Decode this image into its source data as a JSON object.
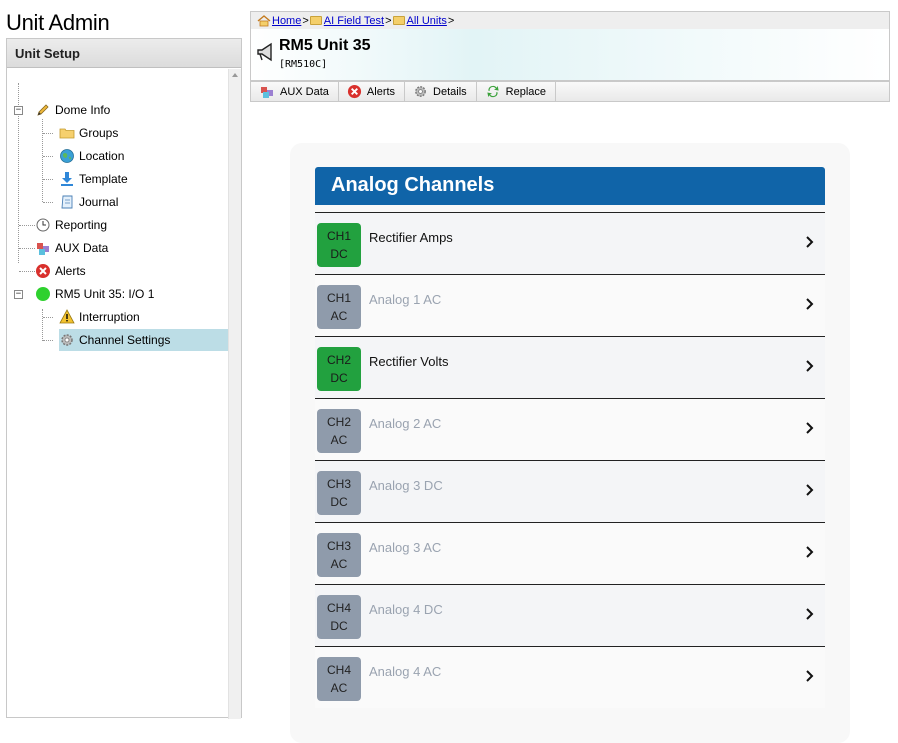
{
  "app": {
    "title": "Unit Admin"
  },
  "left_panel": {
    "header": "Unit Setup",
    "tree": [
      {
        "label": "Dome Info",
        "icon": "pencil-icon"
      },
      {
        "label": "Groups",
        "icon": "folder-icon"
      },
      {
        "label": "Location",
        "icon": "globe-icon"
      },
      {
        "label": "Template",
        "icon": "download-icon"
      },
      {
        "label": "Journal",
        "icon": "journal-icon"
      },
      {
        "label": "Reporting",
        "icon": "clock-icon"
      },
      {
        "label": "AUX Data",
        "icon": "cubes-icon"
      },
      {
        "label": "Alerts",
        "icon": "alert-x-icon"
      },
      {
        "label": "RM5 Unit 35: I/O 1",
        "icon": "green-status-icon"
      },
      {
        "label": "Interruption",
        "icon": "warning-icon"
      },
      {
        "label": "Channel Settings",
        "icon": "gear-icon",
        "selected": true
      }
    ]
  },
  "breadcrumb": {
    "home": "Home",
    "sep": ">",
    "field_test": "AI Field Test",
    "all_units": "All Units"
  },
  "unit": {
    "title": "RM5 Unit 35",
    "model": "[RM510C]"
  },
  "toolbar": {
    "aux_data": "AUX Data",
    "alerts": "Alerts",
    "details": "Details",
    "replace": "Replace"
  },
  "section": {
    "title": "Analog Channels"
  },
  "colors": {
    "active": "#22a13f",
    "inactive": "#8f9bab",
    "header_blue": "#1064a8",
    "selected_bg": "#bcdde6"
  },
  "channels": [
    {
      "ch": "CH1",
      "type": "DC",
      "name": "Rectifier Amps",
      "active": true
    },
    {
      "ch": "CH1",
      "type": "AC",
      "name": "Analog 1 AC",
      "active": false
    },
    {
      "ch": "CH2",
      "type": "DC",
      "name": "Rectifier Volts",
      "active": true
    },
    {
      "ch": "CH2",
      "type": "AC",
      "name": "Analog 2 AC",
      "active": false
    },
    {
      "ch": "CH3",
      "type": "DC",
      "name": "Analog 3 DC",
      "active": false
    },
    {
      "ch": "CH3",
      "type": "AC",
      "name": "Analog 3 AC",
      "active": false
    },
    {
      "ch": "CH4",
      "type": "DC",
      "name": "Analog 4 DC",
      "active": false
    },
    {
      "ch": "CH4",
      "type": "AC",
      "name": "Analog 4 AC",
      "active": false
    }
  ]
}
